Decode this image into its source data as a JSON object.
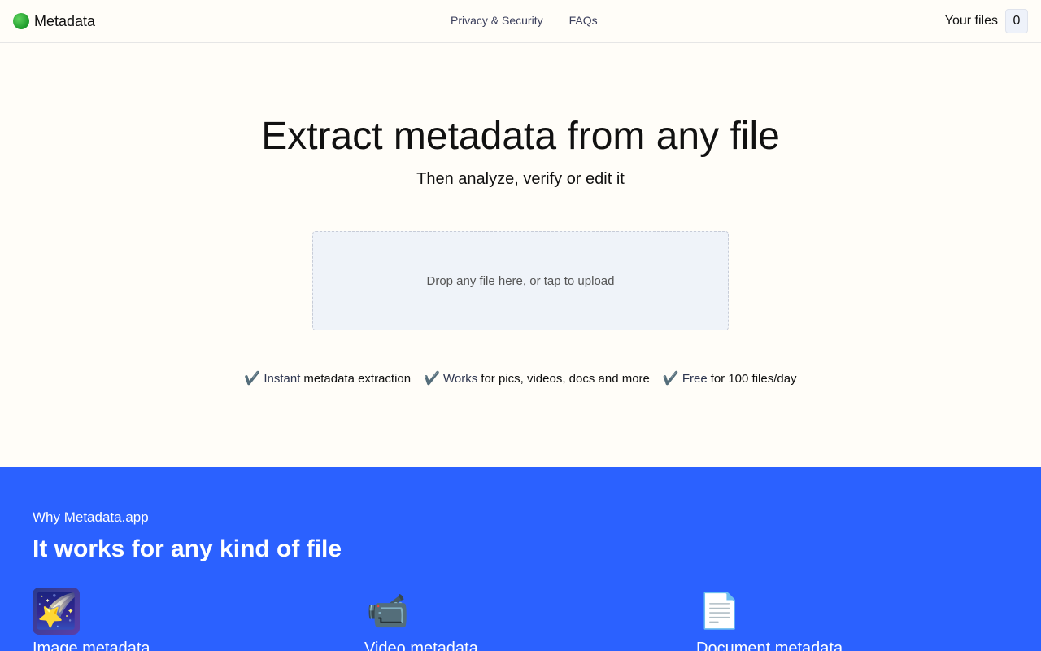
{
  "header": {
    "brand": "Metadata",
    "nav": [
      {
        "label": "Privacy & Security"
      },
      {
        "label": "FAQs"
      }
    ],
    "files_label": "Your files",
    "files_count": "0"
  },
  "hero": {
    "title": "Extract metadata from any file",
    "subtitle": "Then analyze, verify or edit it",
    "dropzone_text": "Drop any file here, or tap to upload",
    "features": [
      {
        "head": "Instant",
        "rest": "metadata extraction"
      },
      {
        "head": "Works",
        "rest": "for pics, videos, docs and more"
      },
      {
        "head": "Free",
        "rest": "for 100 files/day"
      }
    ]
  },
  "why": {
    "kicker": "Why Metadata.app",
    "title": "It works for any kind of file",
    "cards": [
      {
        "icon": "shooting-star-icon",
        "glyph": "🌠",
        "title": "Image metadata"
      },
      {
        "icon": "video-camera-icon",
        "glyph": "📹",
        "title": "Video metadata"
      },
      {
        "icon": "document-icon",
        "glyph": "📄",
        "title": "Document metadata"
      }
    ]
  },
  "colors": {
    "background": "#fffdf8",
    "accent_blue": "#2b61ff",
    "dropzone_bg": "#eff3f9",
    "logo_green": "#1d9a2a"
  }
}
